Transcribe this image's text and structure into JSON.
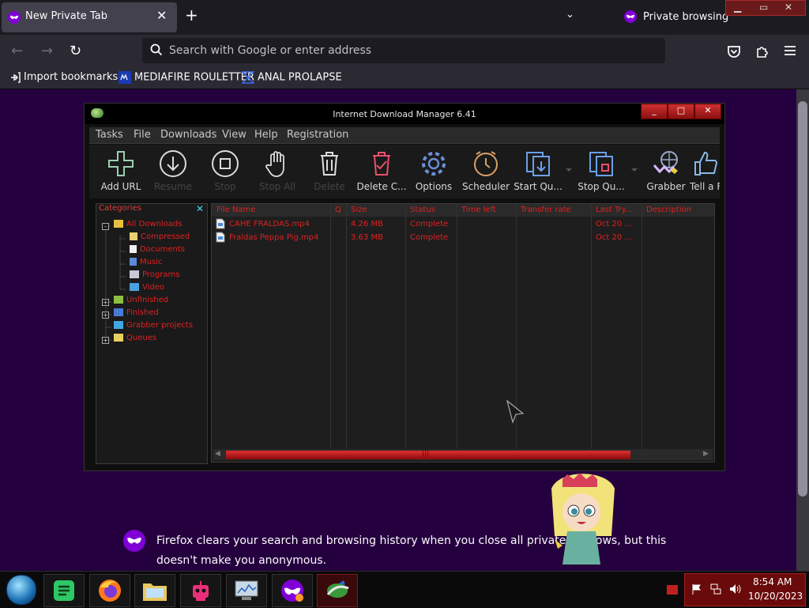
{
  "browser": {
    "tab_title": "New Private Tab",
    "tab_close": "✕",
    "new_tab": "+",
    "tab_list": "⌄",
    "private_label": "Private browsing",
    "window_controls": {
      "minimize": "▁",
      "restore": "▭",
      "close": "✕"
    },
    "search_placeholder": "Search with Google or enter address",
    "nav": {
      "back": "←",
      "forward": "→",
      "reload": "↻"
    },
    "bookmarks": [
      {
        "label": "Import bookmarks...",
        "icon": "import-icon"
      },
      {
        "label": "MEDIAFIRE ROULETTER",
        "icon": "mediafire-icon"
      },
      {
        "label": "ANAL PROLAPSE",
        "icon": "bookmark-icon"
      }
    ],
    "private_notice": "Firefox clears your search and browsing history when you close all private windows, but this doesn't make you anonymous."
  },
  "idm": {
    "title": "Internet Download Manager 6.41",
    "controls": {
      "minimize": "_",
      "maximize": "□",
      "close": "✕"
    },
    "menu": [
      "Tasks",
      "File",
      "Downloads",
      "View",
      "Help",
      "Registration"
    ],
    "toolbar": [
      {
        "label": "Add URL",
        "icon": "add-icon",
        "enabled": true
      },
      {
        "label": "Resume",
        "icon": "resume-icon",
        "enabled": false
      },
      {
        "label": "Stop",
        "icon": "stop-icon",
        "enabled": false
      },
      {
        "label": "Stop All",
        "icon": "hand-icon",
        "enabled": false
      },
      {
        "label": "Delete",
        "icon": "trash-icon",
        "enabled": false
      },
      {
        "label": "Delete C...",
        "icon": "delete-completed-icon",
        "enabled": true
      },
      {
        "label": "Options",
        "icon": "gear-icon",
        "enabled": true
      },
      {
        "label": "Scheduler",
        "icon": "clock-icon",
        "enabled": true
      },
      {
        "label": "Start Qu...",
        "icon": "start-queue-icon",
        "enabled": true
      },
      {
        "label": "Stop Qu...",
        "icon": "stop-queue-icon",
        "enabled": true
      },
      {
        "label": "Grabber",
        "icon": "grabber-icon",
        "enabled": true
      },
      {
        "label": "Tell a F",
        "icon": "thumbs-up-icon",
        "enabled": true
      }
    ],
    "categories": {
      "header": "Categories",
      "close": "✕",
      "items": [
        {
          "label": "All Downloads",
          "icon": "folder-open-icon",
          "expander": "-"
        },
        {
          "label": "Compressed",
          "icon": "zip-icon"
        },
        {
          "label": "Documents",
          "icon": "document-icon"
        },
        {
          "label": "Music",
          "icon": "music-icon"
        },
        {
          "label": "Programs",
          "icon": "program-icon"
        },
        {
          "label": "Video",
          "icon": "video-icon"
        },
        {
          "label": "Unfinished",
          "icon": "unfinished-folder-icon",
          "expander": "+"
        },
        {
          "label": "Finished",
          "icon": "finished-folder-icon",
          "expander": "+"
        },
        {
          "label": "Grabber projects",
          "icon": "grabber-projects-icon"
        },
        {
          "label": "Queues",
          "icon": "queues-folder-icon",
          "expander": "+"
        }
      ]
    },
    "columns": [
      "File Name",
      "Q",
      "Size",
      "Status",
      "Time left",
      "Transfer rate",
      "Last Try...",
      "Description"
    ],
    "files": [
      {
        "name": "CAHE FRALDAS.mp4",
        "q": "",
        "size": "4.26 MB",
        "status": "Complete",
        "time_left": "",
        "transfer_rate": "",
        "last_try": "Oct 20 ...",
        "description": ""
      },
      {
        "name": "Fraldas Peppa Pig.mp4",
        "q": "",
        "size": "3.63 MB",
        "status": "Complete",
        "time_left": "",
        "transfer_rate": "",
        "last_try": "Oct 20 ...",
        "description": ""
      }
    ],
    "scroll_grip": "|||"
  },
  "taskbar": {
    "start": "start-orb-icon",
    "apps": [
      {
        "name": "notes-app",
        "icon": "notes-icon"
      },
      {
        "name": "firefox",
        "icon": "firefox-icon"
      },
      {
        "name": "file-explorer",
        "icon": "folder-icon"
      },
      {
        "name": "robot-app",
        "icon": "robot-icon"
      },
      {
        "name": "task-manager",
        "icon": "monitor-icon"
      },
      {
        "name": "firefox-private",
        "icon": "private-browsing-icon"
      },
      {
        "name": "idm",
        "icon": "idm-icon",
        "active": true
      }
    ],
    "time": "8:54 AM",
    "date": "10/20/2023"
  },
  "colors": {
    "accent_red": "#e02020",
    "private_purple": "#25003e",
    "firefox_bg": "#1c1b22",
    "toolbar_bg": "#2b2a33"
  }
}
